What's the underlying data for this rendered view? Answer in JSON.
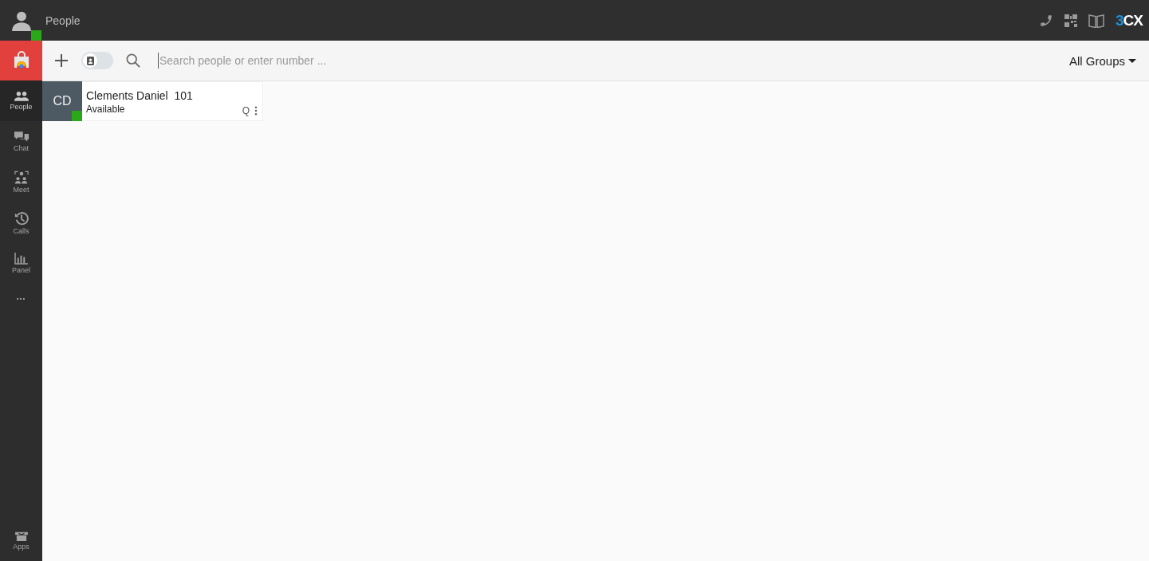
{
  "header": {
    "title": "People",
    "user_online": true,
    "logo": {
      "accent": "3",
      "rest": "CX"
    }
  },
  "sidebar": {
    "items": [
      {
        "kind": "people",
        "label": "People",
        "selected": true
      },
      {
        "kind": "chat",
        "label": "Chat",
        "selected": false
      },
      {
        "kind": "meet",
        "label": "Meet",
        "selected": false
      },
      {
        "kind": "calls",
        "label": "Calls",
        "selected": false
      },
      {
        "kind": "panel",
        "label": "Panel",
        "selected": false
      }
    ],
    "more": "•••",
    "apps": {
      "label": "Apps"
    }
  },
  "toolbar": {
    "contacts_toggle": {
      "on": false
    },
    "search": {
      "placeholder": "Search people or enter number ..."
    },
    "groups": "All Groups"
  },
  "contacts": [
    {
      "initials": "CD",
      "name": "Clements Daniel",
      "extension": "101",
      "status": "Available",
      "color": "#2aa81a",
      "queue": "Q"
    }
  ]
}
